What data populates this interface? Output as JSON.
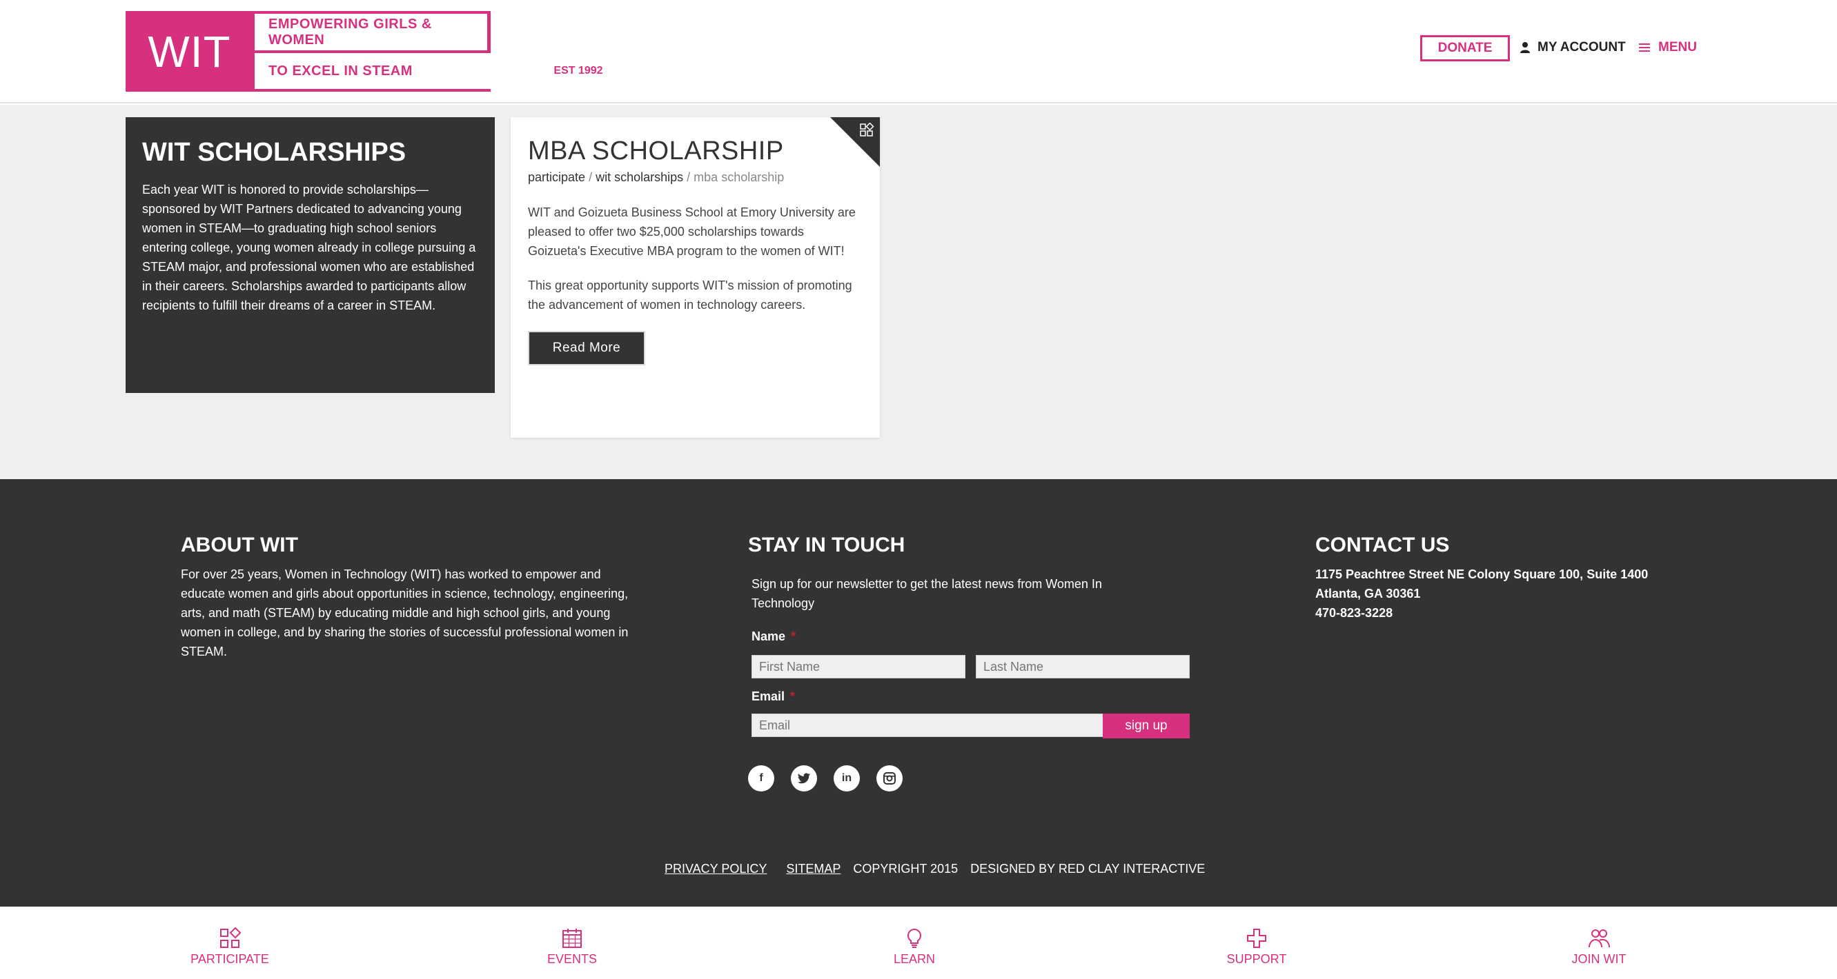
{
  "header": {
    "logo_wit": "WIT",
    "logo_tagline_top": "EMPOWERING GIRLS & WOMEN",
    "logo_tagline_bottom": "TO EXCEL IN STEAM",
    "logo_est": "EST 1992",
    "donate_label": "DONATE",
    "account_label": "MY ACCOUNT",
    "menu_label": "MENU"
  },
  "intro": {
    "title": "WIT SCHOLARSHIPS",
    "body": "Each year WIT is honored to provide scholarships—sponsored by WIT Partners dedicated to advancing young women in STEAM—to graduating high school seniors entering college, young women already in college pursuing a STEAM major, and professional women who are established in their careers. Scholarships awarded to participants allow recipients to fulfill their dreams of a career in STEAM."
  },
  "card": {
    "title": "MBA SCHOLARSHIP",
    "breadcrumb": {
      "level1": "participate",
      "sep": "/",
      "level2": "wit scholarships",
      "current": "mba scholarship"
    },
    "paragraph1": "WIT and Goizueta Business School at Emory University are pleased to offer two $25,000 scholarships towards Goizueta's Executive MBA program to the women of WIT!",
    "paragraph2": "This great opportunity supports WIT's mission of promoting the advancement of women in technology careers.",
    "button_label": "Read More"
  },
  "footer": {
    "about": {
      "title": "ABOUT WIT",
      "text": "For over 25 years, Women in Technology (WIT) has worked to empower and educate women and girls about opportunities in science, technology, engineering, arts, and math (STEAM) by educating middle and high school girls, and young women in college, and by sharing the stories of successful professional women in STEAM."
    },
    "stay": {
      "title": "STAY IN TOUCH",
      "text": "Sign up for our newsletter to get the latest news from Women In Technology",
      "name_label": "Name",
      "required_mark": "*",
      "first_placeholder": "First Name",
      "last_placeholder": "Last Name",
      "email_label": "Email",
      "email_placeholder": "Email",
      "signup_label": "sign up",
      "social_glyphs": {
        "facebook": "f",
        "linkedin": "in"
      }
    },
    "contact": {
      "title": "CONTACT US",
      "address1": "1175 Peachtree Street NE Colony Square 100, Suite 1400",
      "address2": "Atlanta, GA 30361",
      "phone": "470-823-3228"
    },
    "links": {
      "privacy": "PRIVACY POLICY",
      "sitemap": "SITEMAP",
      "copyright": "COPYRIGHT 2015",
      "designer": "DESIGNED BY RED CLAY INTERACTIVE"
    }
  },
  "bottom_nav": [
    {
      "label": "PARTICIPATE",
      "icon": "participate-icon"
    },
    {
      "label": "EVENTS",
      "icon": "calendar-icon"
    },
    {
      "label": "LEARN",
      "icon": "lightbulb-icon"
    },
    {
      "label": "SUPPORT",
      "icon": "cross-icon"
    },
    {
      "label": "JOIN WIT",
      "icon": "people-icon"
    }
  ],
  "colors": {
    "accent": "#d6307f",
    "dark": "#333333",
    "background": "#efefef"
  }
}
